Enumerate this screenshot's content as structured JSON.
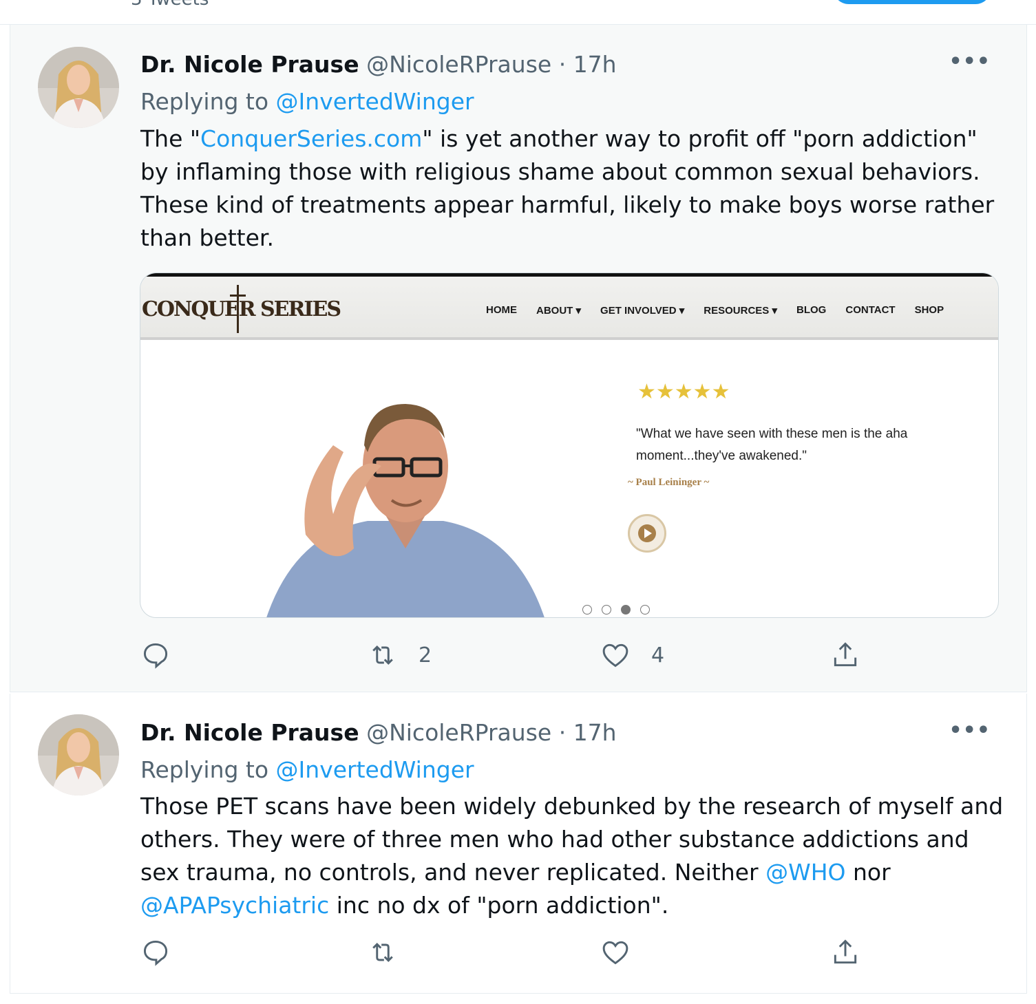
{
  "tweets": [
    {
      "name": "Dr. Nicole Prause",
      "handle": "@NicoleRPrause",
      "dot": "·",
      "time": "17h",
      "more": "•••",
      "replying_prefix": "Replying to ",
      "replying_to": "@InvertedWinger",
      "text_segments": [
        "The \"",
        "ConquerSeries.com",
        "\" is yet another way to profit off \"porn addiction\" by inflaming those with religious shame about common sexual behaviors. These kind of treatments appear harmful, likely to make boys worse rather than better."
      ],
      "reply_count": "",
      "retweet_count": "2",
      "like_count": "4"
    },
    {
      "name": "Dr. Nicole Prause",
      "handle": "@NicoleRPrause",
      "dot": "·",
      "time": "17h",
      "more": "•••",
      "replying_prefix": "Replying to ",
      "replying_to": "@InvertedWinger",
      "text_segments": [
        "Those PET scans have been widely debunked by the research of myself and others. They were of three men who had other substance addictions and sex trauma, no controls, and never replicated. Neither ",
        "@WHO",
        " nor ",
        "@APAPsychiatric",
        " inc no dx of \"porn addiction\"."
      ],
      "reply_count": "",
      "retweet_count": "",
      "like_count": ""
    }
  ],
  "card": {
    "logo": "CONQUER SERIES",
    "nav": [
      "HOME",
      "ABOUT ▾",
      "GET INVOLVED ▾",
      "RESOURCES ▾",
      "BLOG",
      "CONTACT",
      "SHOP"
    ],
    "stars": "★★★★★",
    "quote": "\"What we have seen with these men is the aha moment...they've awakened.\"",
    "attribution": "~ Paul Leininger ~",
    "carousel_active_index": 2,
    "carousel_count": 4
  },
  "colors": {
    "link": "#1d9bf0",
    "secondary_text": "#536471",
    "highlight_bg": "#f7f9f9",
    "star": "#e6c13a",
    "gold": "#a8804a"
  },
  "icons": [
    "reply-icon",
    "retweet-icon",
    "like-icon",
    "share-icon",
    "more-icon",
    "play-icon"
  ]
}
